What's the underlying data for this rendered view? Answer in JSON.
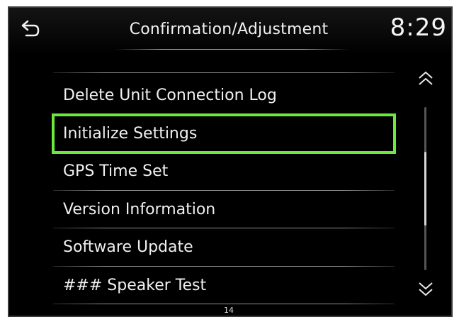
{
  "header": {
    "title": "Confirmation/Adjustment",
    "clock": "8:29",
    "back_icon": "back-arrow-icon"
  },
  "menu": {
    "items": [
      {
        "label": "Delete Unit Connection Log",
        "highlighted": false
      },
      {
        "label": "Initialize Settings",
        "highlighted": true
      },
      {
        "label": "GPS Time Set",
        "highlighted": false
      },
      {
        "label": "Version Information",
        "highlighted": false
      },
      {
        "label": "Software Update",
        "highlighted": false
      },
      {
        "label": "### Speaker Test",
        "highlighted": false
      }
    ]
  },
  "scrollbar": {
    "up_icon": "chevron-double-up-icon",
    "down_icon": "chevron-double-down-icon",
    "position": 0.5,
    "visible_fraction": 0.45
  },
  "footer": {
    "page_number": "14"
  },
  "colors": {
    "background": "#000000",
    "highlight": "#6aea3c",
    "text": "#f0f0f0"
  }
}
